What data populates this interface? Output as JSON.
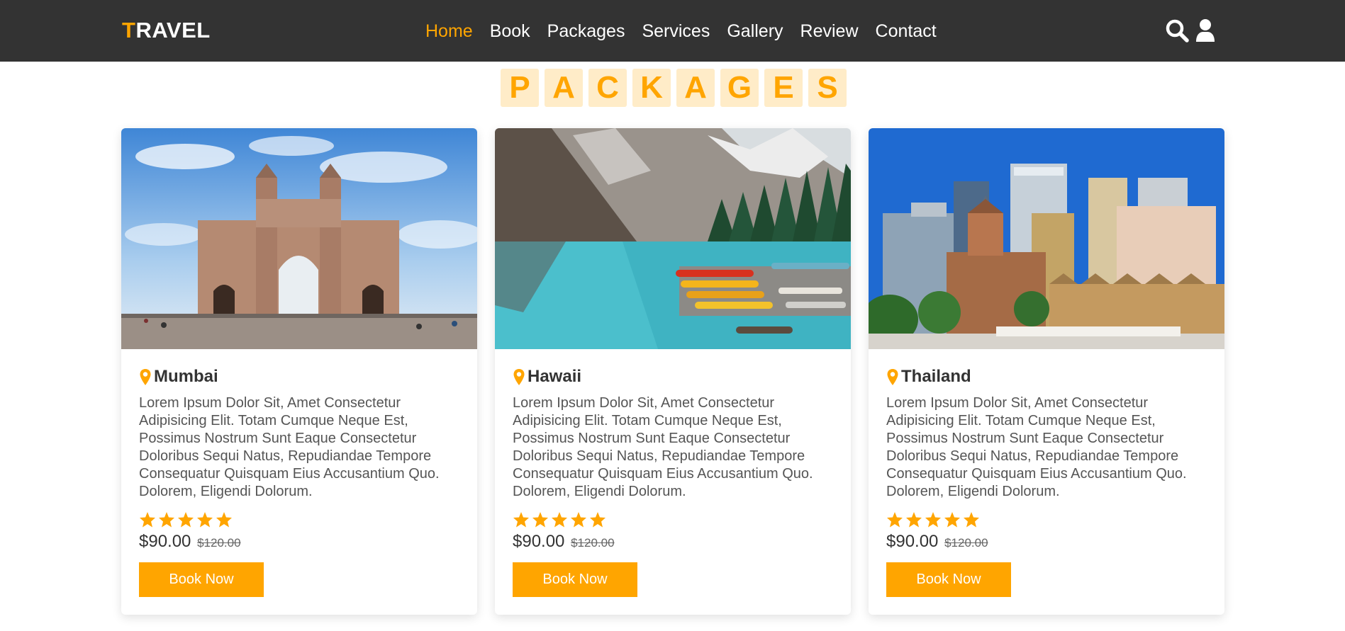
{
  "brand": {
    "first_letter": "T",
    "rest": "RAVEL",
    "accent": "#ffa500"
  },
  "nav": {
    "items": [
      {
        "label": "Home",
        "active": true
      },
      {
        "label": "Book"
      },
      {
        "label": "Packages"
      },
      {
        "label": "Services"
      },
      {
        "label": "Gallery"
      },
      {
        "label": "Review"
      },
      {
        "label": "Contact"
      }
    ],
    "icons": [
      "search-icon",
      "user-icon"
    ]
  },
  "heading": {
    "letters": [
      "P",
      "A",
      "C",
      "K",
      "A",
      "G",
      "E",
      "S"
    ]
  },
  "packages": [
    {
      "image": "gateway-of-india-photo",
      "title": "Mumbai",
      "description": "Lorem Ipsum Dolor Sit, Amet Consectetur Adipisicing Elit. Totam Cumque Neque Est, Possimus Nostrum Sunt Eaque Consectetur Doloribus Sequi Natus, Repudiandae Tempore Consequatur Quisquam Eius Accusantium Quo. Dolorem, Eligendi Dolorum.",
      "rating": 5,
      "price": "$90.00",
      "old_price": "$120.00",
      "button": "Book Now"
    },
    {
      "image": "mountain-lake-photo",
      "title": "Hawaii",
      "description": "Lorem Ipsum Dolor Sit, Amet Consectetur Adipisicing Elit. Totam Cumque Neque Est, Possimus Nostrum Sunt Eaque Consectetur Doloribus Sequi Natus, Repudiandae Tempore Consequatur Quisquam Eius Accusantium Quo. Dolorem, Eligendi Dolorum.",
      "rating": 5,
      "price": "$90.00",
      "old_price": "$120.00",
      "button": "Book Now"
    },
    {
      "image": "city-skyline-photo",
      "title": "Thailand",
      "description": "Lorem Ipsum Dolor Sit, Amet Consectetur Adipisicing Elit. Totam Cumque Neque Est, Possimus Nostrum Sunt Eaque Consectetur Doloribus Sequi Natus, Repudiandae Tempore Consequatur Quisquam Eius Accusantium Quo. Dolorem, Eligendi Dolorum.",
      "rating": 5,
      "price": "$90.00",
      "old_price": "$120.00",
      "button": "Book Now"
    }
  ],
  "colors": {
    "nav_bg": "#333333",
    "accent": "#ffa500",
    "heading_tile": "#ffecc8"
  }
}
